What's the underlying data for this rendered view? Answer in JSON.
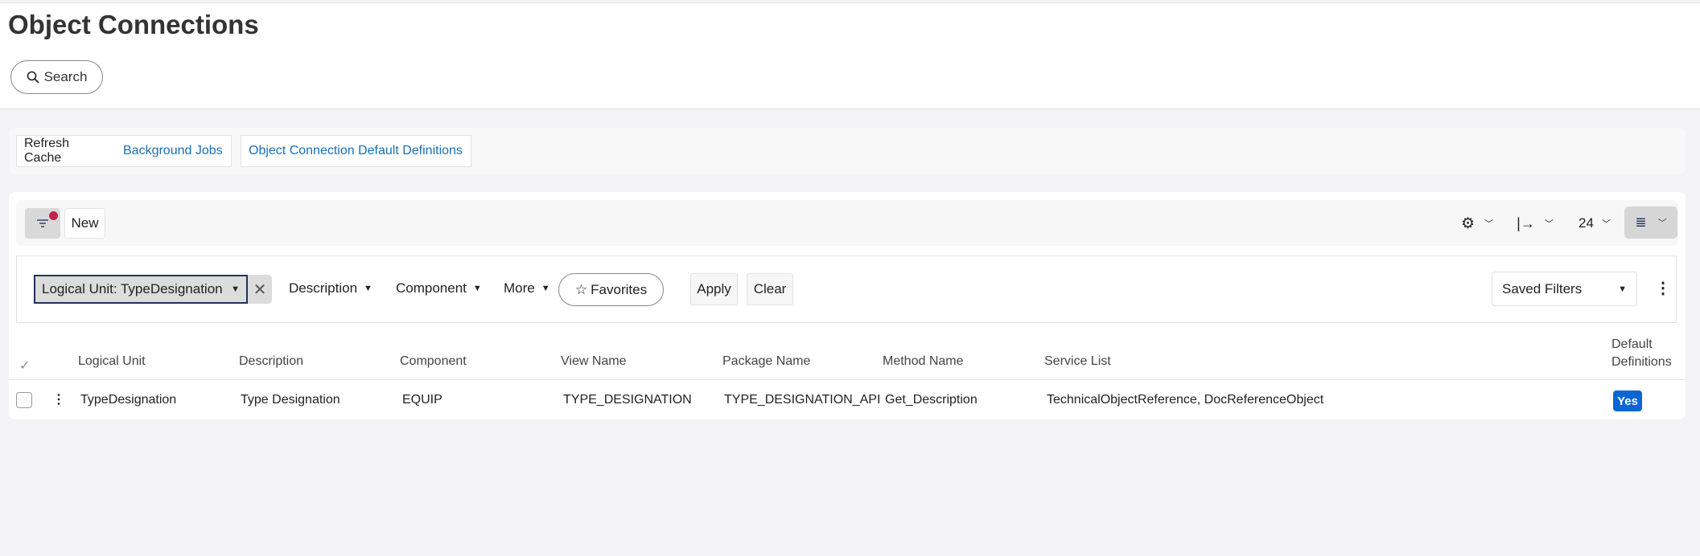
{
  "page": {
    "title": "Object Connections",
    "search_label": "Search"
  },
  "commands": {
    "refresh": "Refresh Cache",
    "background": "Background Jobs",
    "defaults": "Object Connection Default Definitions"
  },
  "toolbar": {
    "new_label": "New",
    "page_size": "24"
  },
  "filters": {
    "chip": "Logical Unit: TypeDesignation",
    "description": "Description",
    "component": "Component",
    "more": "More",
    "favorites": "Favorites",
    "apply": "Apply",
    "clear": "Clear",
    "saved_filters": "Saved Filters"
  },
  "table": {
    "columns": [
      "Logical Unit",
      "Description",
      "Component",
      "View Name",
      "Package Name",
      "Method Name",
      "Service List",
      "Default",
      "Definitions"
    ],
    "rows": [
      {
        "logical_unit": "TypeDesignation",
        "description": "Type Designation",
        "component": "EQUIP",
        "view_name": "TYPE_DESIGNATION",
        "package_name": "TYPE_DESIGNATION_API",
        "method_name": "Get_Description",
        "service_list": "TechnicalObjectReference, DocReferenceObject",
        "default_definitions": "Yes"
      }
    ]
  },
  "colors": {
    "accent": "#1a6fb5",
    "badge": "#0b66d4",
    "notify": "#c0234e"
  }
}
